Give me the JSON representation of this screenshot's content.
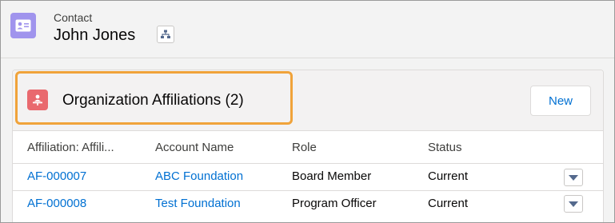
{
  "header": {
    "object_label": "Contact",
    "record_name": "John Jones",
    "icon": "contact-card-icon",
    "hierarchy_icon": "hierarchy-icon"
  },
  "related_list": {
    "title": "Organization Affiliations (2)",
    "icon": "affiliation-icon",
    "new_label": "New",
    "highlight_color": "#f0a33a",
    "columns": [
      "Affiliation: Affili...",
      "Account Name",
      "Role",
      "Status"
    ],
    "rows": [
      {
        "affiliation": "AF-000007",
        "account": "ABC Foundation",
        "role": "Board Member",
        "status": "Current"
      },
      {
        "affiliation": "AF-000008",
        "account": "Test Foundation",
        "role": "Program Officer",
        "status": "Current"
      }
    ]
  },
  "colors": {
    "link": "#0070d2",
    "contact_icon_bg": "#a094ed",
    "affiliation_icon_bg": "#e9696e"
  }
}
